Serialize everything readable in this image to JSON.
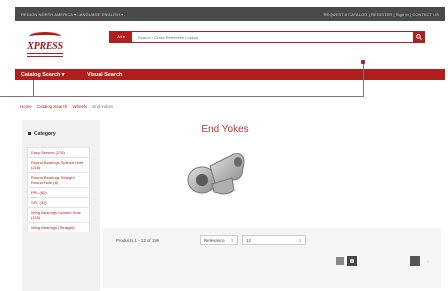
{
  "topbar": {
    "left": "REGION   NORTH AMERICA ▾     LANGUAGE   ENGLISH ▾",
    "right": "REQUEST A CATALOG  |  REGISTER  |  Sign in  |  CONTACT US"
  },
  "logo": {
    "text": "XPRESS"
  },
  "search": {
    "select_label": "All ▾",
    "placeholder": "Search / Cross Reference Lookup"
  },
  "nav": {
    "items": [
      {
        "label": "Catalog Search ▾"
      },
      {
        "label": "Visual Search"
      }
    ]
  },
  "breadcrumb": {
    "items": [
      "Home",
      "Catalog Search",
      "Wheels",
      "End Yokes"
    ]
  },
  "sidebar": {
    "heading": "Category",
    "items": [
      "Easy Service (276)",
      "Round Bearings Splined Hole (216)",
      "Round Bearings Straight Round Hole (8)",
      "PPL (60)",
      "SPL (30)",
      "Wing Bearings Splined Hole (118)",
      "Wing Bearings (Straight)"
    ]
  },
  "main": {
    "title": "End Yokes",
    "product_count": "Products 1 - 12 of 196",
    "sort_value": "Relevance",
    "per_page_value": "12"
  },
  "colors": {
    "brand_red": "#b21d1d",
    "topbar": "#4a4a4a"
  }
}
